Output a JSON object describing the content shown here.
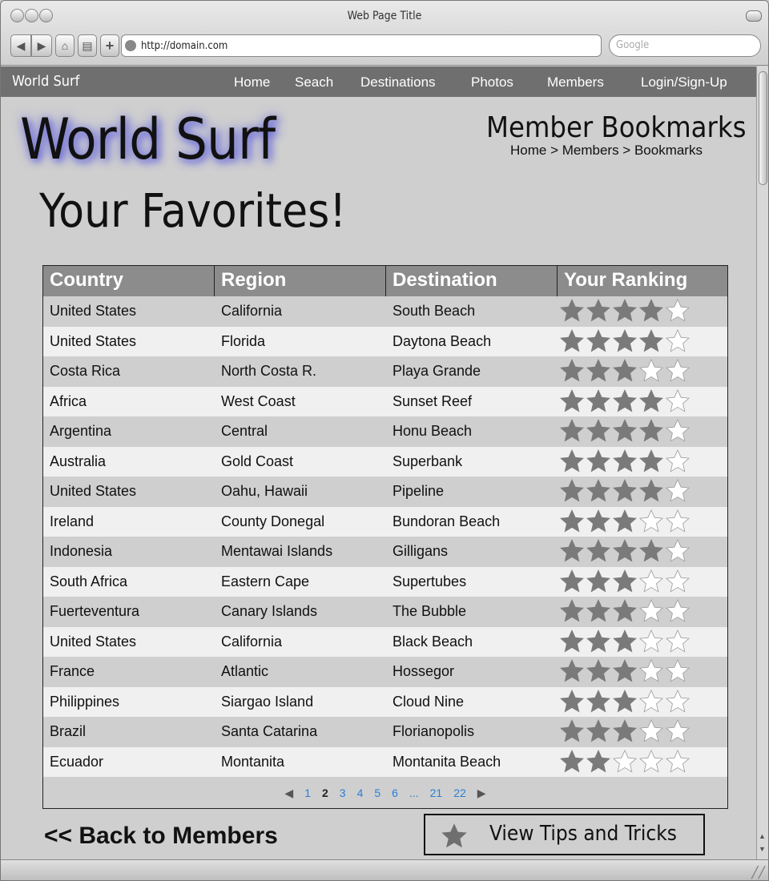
{
  "window": {
    "title": "Web Page Title",
    "url": "http://domain.com",
    "search_placeholder": "Google"
  },
  "site": {
    "brand": "World Surf",
    "nav": [
      "Home",
      "Seach",
      "Destinations",
      "Photos",
      "Members",
      "Login/Sign-Up"
    ],
    "logo": "World Surf",
    "page_title": "Member Bookmarks",
    "breadcrumb": "Home > Members > Bookmarks",
    "heading": "Your Favorites!"
  },
  "table": {
    "headers": [
      "Country",
      "Region",
      "Destination",
      "Your Ranking"
    ],
    "rows": [
      {
        "country": "United States",
        "region": "California",
        "destination": "South Beach",
        "ranking": 4
      },
      {
        "country": "United States",
        "region": "Florida",
        "destination": "Daytona Beach",
        "ranking": 4
      },
      {
        "country": "Costa Rica",
        "region": "North Costa R.",
        "destination": "Playa Grande",
        "ranking": 3
      },
      {
        "country": "Africa",
        "region": "West Coast",
        "destination": " Sunset Reef",
        "ranking": 4
      },
      {
        "country": "Argentina",
        "region": "Central",
        "destination": "Honu Beach",
        "ranking": 4
      },
      {
        "country": "Australia",
        "region": "Gold Coast",
        "destination": "Superbank",
        "ranking": 4
      },
      {
        "country": "United States",
        "region": "Oahu, Hawaii",
        "destination": "Pipeline",
        "ranking": 4
      },
      {
        "country": "Ireland",
        "region": "County Donegal",
        "destination": "Bundoran Beach",
        "ranking": 3
      },
      {
        "country": "Indonesia",
        "region": "Mentawai Islands",
        "destination": "Gilligans",
        "ranking": 4
      },
      {
        "country": "South Africa",
        "region": "Eastern Cape",
        "destination": "Supertubes",
        "ranking": 3
      },
      {
        "country": "Fuerteventura",
        "region": "Canary Islands",
        "destination": "The Bubble",
        "ranking": 3
      },
      {
        "country": "United States",
        "region": "California",
        "destination": "Black Beach",
        "ranking": 3
      },
      {
        "country": "France",
        "region": "Atlantic",
        "destination": "Hossegor",
        "ranking": 3
      },
      {
        "country": "Philippines",
        "region": "Siargao Island",
        "destination": "Cloud Nine",
        "ranking": 3
      },
      {
        "country": "Brazil",
        "region": "Santa Catarina",
        "destination": "Florianopolis",
        "ranking": 3
      },
      {
        "country": "Ecuador",
        "region": "Montanita",
        "destination": "Montanita Beach",
        "ranking": 2
      }
    ],
    "max_rank": 5
  },
  "pagination": {
    "pages": [
      "1",
      "2",
      "3",
      "4",
      "5",
      "6",
      "...",
      "21",
      "22"
    ],
    "current": "2"
  },
  "actions": {
    "back": "<< Back to Members",
    "tips": "View Tips and Tricks"
  },
  "colors": {
    "nav_bg": "#6f6f6f",
    "header_bg": "#8c8c8c",
    "row_dark": "#cfcfcf",
    "row_light": "#f0f0f0",
    "star_filled": "#7a7a7a",
    "link": "#2a7fd4"
  }
}
